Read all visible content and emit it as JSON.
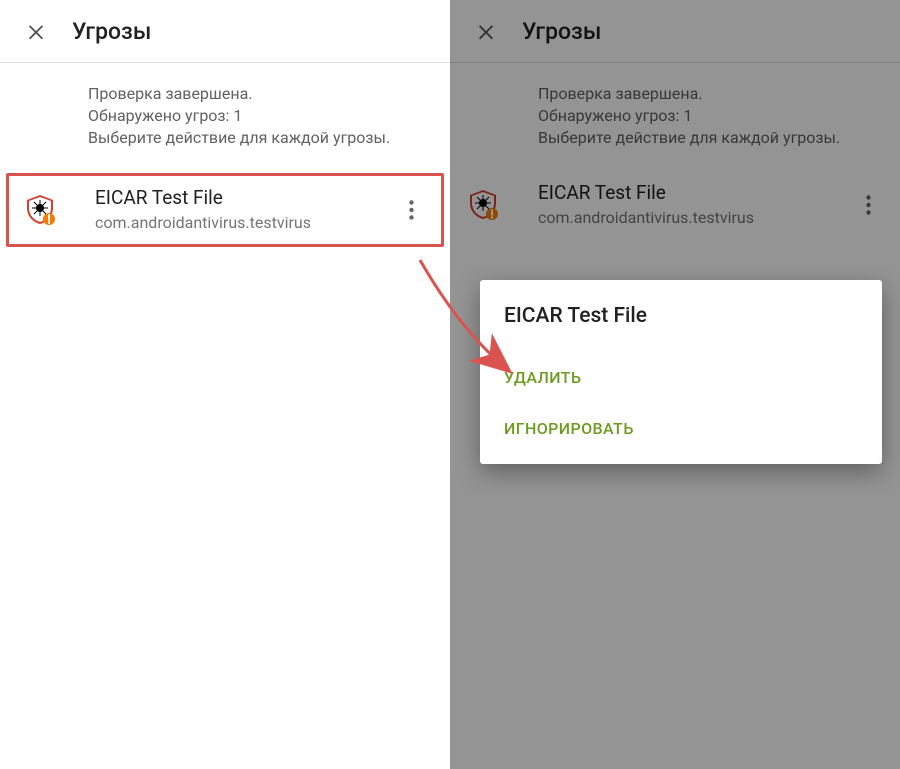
{
  "left": {
    "title": "Угрозы",
    "summary_line1": "Проверка завершена.",
    "summary_line2": "Обнаружено угроз: 1",
    "summary_line3": "Выберите действие для каждой угрозы.",
    "threat": {
      "name": "EICAR Test File",
      "package": "com.androidantivirus.testvirus"
    }
  },
  "right": {
    "title": "Угрозы",
    "summary_line1": "Проверка завершена.",
    "summary_line2": "Обнаружено угроз: 1",
    "summary_line3": "Выберите действие для каждой угрозы.",
    "threat": {
      "name": "EICAR Test File",
      "package": "com.androidantivirus.testvirus"
    },
    "sheet": {
      "title": "EICAR Test File",
      "action_delete": "УДАЛИТЬ",
      "action_ignore": "ИГНОРИРОВАТЬ"
    }
  }
}
